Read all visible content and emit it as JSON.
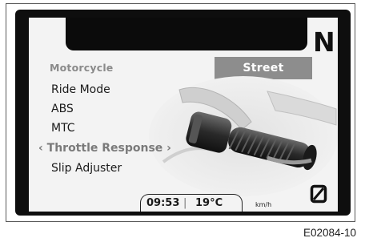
{
  "display": {
    "gear": "N",
    "menu": {
      "header": "Motorcycle",
      "selected_value": "Street",
      "items": [
        {
          "label": "Ride Mode"
        },
        {
          "label": "ABS"
        },
        {
          "label": "MTC"
        },
        {
          "label": "‹ Throttle Response ›",
          "selected": true
        },
        {
          "label": "Slip Adjuster"
        }
      ]
    },
    "status": {
      "time": "09:53",
      "separator": "|",
      "temperature": "19°C",
      "speed_unit": "km/h"
    },
    "icons": {
      "illustration": "throttle-grip-illustration",
      "indicator": "zero-slash-icon"
    }
  },
  "figure_code": "E02084-10"
}
